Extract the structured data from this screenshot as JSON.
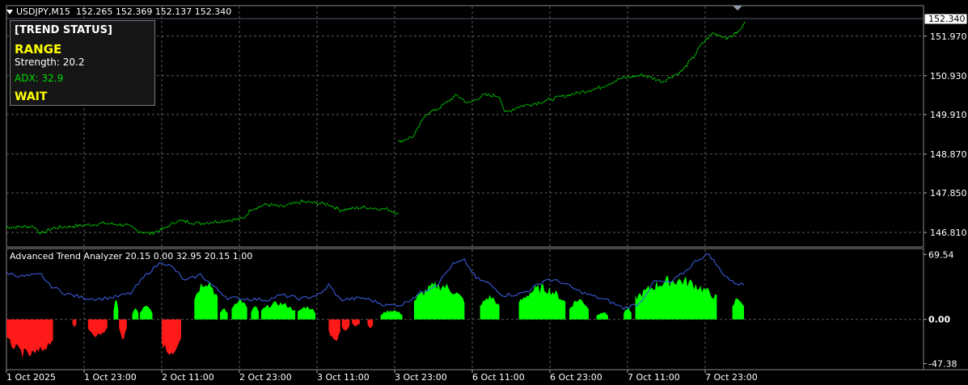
{
  "header": {
    "symbol": "USDJPY,M15",
    "ohlc": "152.265 152.369 152.137 152.340"
  },
  "trend_box": {
    "title": "[TREND STATUS]",
    "state": "RANGE",
    "strength": "Strength: 20.2",
    "adx": "ADX: 32.9",
    "action": "WAIT"
  },
  "indicator": {
    "title": "Advanced Trend Analyzer 20.15 0.00 32.95 20.15 1.00"
  },
  "price_axis": {
    "current_price": "152.340",
    "labels": [
      "151.970",
      "150.930",
      "149.910",
      "148.870",
      "147.850",
      "146.810"
    ]
  },
  "indicator_axis": {
    "labels": [
      "69.54",
      "0.00",
      "-47.38"
    ]
  },
  "time_axis": {
    "labels": [
      "1 Oct 2025",
      "1 Oct 23:00",
      "2 Oct 11:00",
      "2 Oct 23:00",
      "3 Oct 11:00",
      "3 Oct 23:00",
      "6 Oct 11:00",
      "6 Oct 23:00",
      "7 Oct 11:00",
      "7 Oct 23:00"
    ]
  },
  "colors": {
    "background": "#000000",
    "grid": "#5a5a5a",
    "candles": "#00c800",
    "adx_line": "#3a5ad8",
    "hist_positive": "#00ff00",
    "hist_negative": "#ff1a1a",
    "trend_state": "#ffff00",
    "adx_text": "#00dd00"
  },
  "icons": [
    "dropdown-arrow-icon",
    "shift-marker-icon"
  ],
  "chart_data": {
    "type": "line",
    "price_series": {
      "name": "USDJPY,M15",
      "x": [
        "1 Oct 2025",
        "1 Oct 23:00",
        "2 Oct 11:00",
        "2 Oct 23:00",
        "3 Oct 11:00",
        "3 Oct 23:00",
        "6 Oct 11:00",
        "6 Oct 23:00",
        "7 Oct 11:00",
        "7 Oct 23:00"
      ],
      "anchors": [
        [
          0,
          146.95
        ],
        [
          0.35,
          146.97
        ],
        [
          0.45,
          146.78
        ],
        [
          0.6,
          146.93
        ],
        [
          1.0,
          147.0
        ],
        [
          1.25,
          147.05
        ],
        [
          1.55,
          147.0
        ],
        [
          1.7,
          146.85
        ],
        [
          1.85,
          146.78
        ],
        [
          2.05,
          146.93
        ],
        [
          2.2,
          147.12
        ],
        [
          2.5,
          147.05
        ],
        [
          2.8,
          147.12
        ],
        [
          3.05,
          147.17
        ],
        [
          3.15,
          147.42
        ],
        [
          3.35,
          147.55
        ],
        [
          3.55,
          147.48
        ],
        [
          3.8,
          147.62
        ],
        [
          4.15,
          147.55
        ],
        [
          4.3,
          147.4
        ],
        [
          4.6,
          147.47
        ],
        [
          4.9,
          147.42
        ],
        [
          5.05,
          147.32
        ],
        [
          5.05,
          149.18
        ],
        [
          5.25,
          149.35
        ],
        [
          5.4,
          149.92
        ],
        [
          5.55,
          150.05
        ],
        [
          5.8,
          150.42
        ],
        [
          5.95,
          150.2
        ],
        [
          6.15,
          150.42
        ],
        [
          6.35,
          150.4
        ],
        [
          6.42,
          149.95
        ],
        [
          6.6,
          150.12
        ],
        [
          6.85,
          150.22
        ],
        [
          7.15,
          150.38
        ],
        [
          7.45,
          150.52
        ],
        [
          7.65,
          150.62
        ],
        [
          7.9,
          150.85
        ],
        [
          8.2,
          150.95
        ],
        [
          8.45,
          150.78
        ],
        [
          8.7,
          151.05
        ],
        [
          8.85,
          151.42
        ],
        [
          8.95,
          151.75
        ],
        [
          9.1,
          152.05
        ],
        [
          9.3,
          151.92
        ],
        [
          9.45,
          152.12
        ],
        [
          9.52,
          152.35
        ]
      ],
      "ylim": [
        146.45,
        152.75
      ]
    },
    "indicator_series": {
      "name": "Advanced Trend Analyzer",
      "ylim": [
        -53,
        75
      ],
      "adx_anchors": [
        [
          0,
          50
        ],
        [
          0.2,
          46
        ],
        [
          0.45,
          48
        ],
        [
          0.55,
          37
        ],
        [
          0.75,
          28
        ],
        [
          1.0,
          23
        ],
        [
          1.2,
          22
        ],
        [
          1.4,
          24
        ],
        [
          1.6,
          28
        ],
        [
          1.8,
          48
        ],
        [
          2.0,
          62
        ],
        [
          2.15,
          55
        ],
        [
          2.3,
          41
        ],
        [
          2.5,
          48
        ],
        [
          2.7,
          33
        ],
        [
          2.85,
          23
        ],
        [
          3.1,
          22
        ],
        [
          3.35,
          21
        ],
        [
          3.55,
          26
        ],
        [
          3.8,
          22
        ],
        [
          4.05,
          27
        ],
        [
          4.15,
          37
        ],
        [
          4.3,
          21
        ],
        [
          4.6,
          23
        ],
        [
          4.9,
          15
        ],
        [
          5.1,
          16
        ],
        [
          5.3,
          27
        ],
        [
          5.55,
          38
        ],
        [
          5.75,
          59
        ],
        [
          5.9,
          63
        ],
        [
          6.05,
          44
        ],
        [
          6.2,
          39
        ],
        [
          6.4,
          26
        ],
        [
          6.6,
          27
        ],
        [
          6.75,
          32
        ],
        [
          6.95,
          43
        ],
        [
          7.15,
          40
        ],
        [
          7.35,
          31
        ],
        [
          7.55,
          25
        ],
        [
          7.75,
          20
        ],
        [
          7.95,
          12
        ],
        [
          8.15,
          17
        ],
        [
          8.35,
          41
        ],
        [
          8.55,
          39
        ],
        [
          8.75,
          52
        ],
        [
          8.9,
          64
        ],
        [
          9.05,
          70
        ],
        [
          9.2,
          52
        ],
        [
          9.35,
          40
        ],
        [
          9.5,
          37
        ]
      ],
      "hist_segments": [
        [
          0,
          0.6,
          -40
        ],
        [
          0.85,
          0.9,
          -10
        ],
        [
          1.05,
          1.3,
          -18
        ],
        [
          1.45,
          1.55,
          -20
        ],
        [
          1.38,
          1.44,
          20
        ],
        [
          1.62,
          1.7,
          12
        ],
        [
          1.72,
          1.88,
          14
        ],
        [
          2.0,
          2.25,
          -42
        ],
        [
          2.42,
          2.72,
          43
        ],
        [
          2.75,
          2.85,
          12
        ],
        [
          2.9,
          3.1,
          22
        ],
        [
          3.15,
          3.25,
          14
        ],
        [
          3.28,
          3.72,
          18
        ],
        [
          3.75,
          3.98,
          14
        ],
        [
          4.15,
          4.3,
          -24
        ],
        [
          4.32,
          4.42,
          -14
        ],
        [
          4.45,
          4.55,
          -8
        ],
        [
          4.65,
          4.72,
          -10
        ],
        [
          4.82,
          5.1,
          10
        ],
        [
          5.25,
          5.9,
          38
        ],
        [
          6.1,
          6.35,
          25
        ],
        [
          6.6,
          7.2,
          35
        ],
        [
          7.25,
          7.5,
          22
        ],
        [
          7.6,
          7.75,
          8
        ],
        [
          7.95,
          8.05,
          12
        ],
        [
          8.1,
          9.15,
          44
        ],
        [
          9.35,
          9.5,
          24
        ]
      ]
    }
  }
}
